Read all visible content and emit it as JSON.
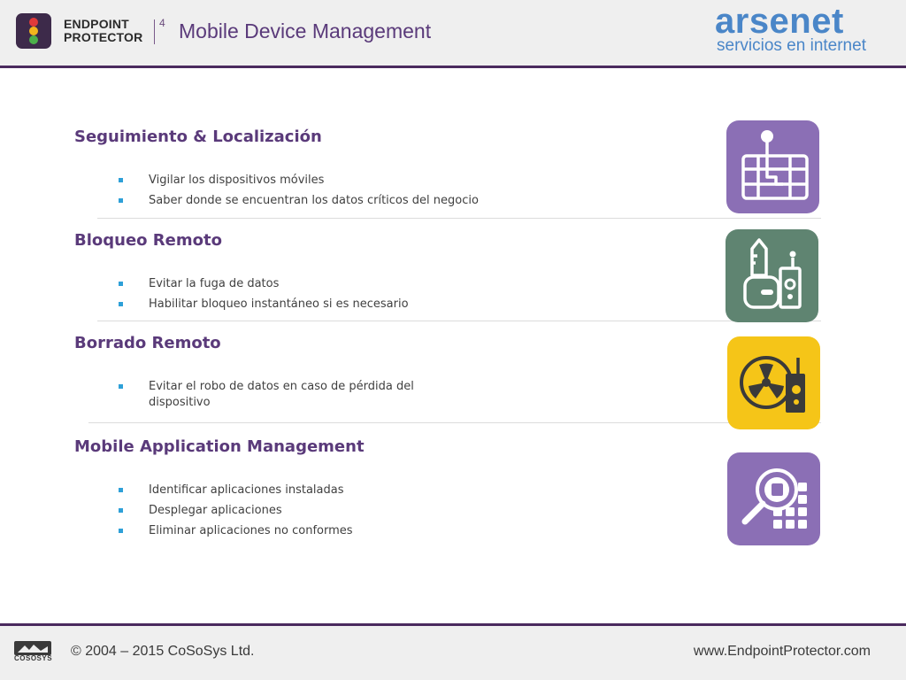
{
  "header": {
    "brand_line1": "ENDPOINT",
    "brand_line2": "PROTECTOR",
    "version": "4",
    "title": "Mobile Device Management",
    "partner_name": "arsenet",
    "partner_tagline": "servicios en internet"
  },
  "sections": [
    {
      "title": "Seguimiento & Localización",
      "icon": "map-pin-icon",
      "tile_color": "#8b6fb5",
      "bullets": [
        "Vigilar los dispositivos móviles",
        "Saber donde se encuentran los datos críticos del negocio"
      ]
    },
    {
      "title": "Bloqueo Remoto",
      "icon": "key-lock-remote-icon",
      "tile_color": "#5f8471",
      "bullets": [
        "Evitar la fuga de datos",
        "Habilitar bloqueo instantáneo si es necesario"
      ]
    },
    {
      "title": "Borrado Remoto",
      "icon": "radiation-remote-icon",
      "tile_color": "#f5c518",
      "bullets": [
        "Evitar el robo de datos en caso de pérdida del",
        "dispositivo"
      ]
    },
    {
      "title": "Mobile Application Management",
      "icon": "app-search-icon",
      "tile_color": "#8b6fb5",
      "bullets": [
        "Identificar aplicaciones instaladas",
        "Desplegar aplicaciones",
        "Eliminar aplicaciones no conformes"
      ]
    }
  ],
  "footer": {
    "logo_text": "COSOSYS",
    "copyright": "© 2004 – 2015 CoSoSys Ltd.",
    "website": "www.EndpointProtector.com"
  },
  "colors": {
    "accent_purple": "#5a3a7a",
    "bullet_blue": "#2ea0d8",
    "partner_blue": "#4a86c8"
  }
}
